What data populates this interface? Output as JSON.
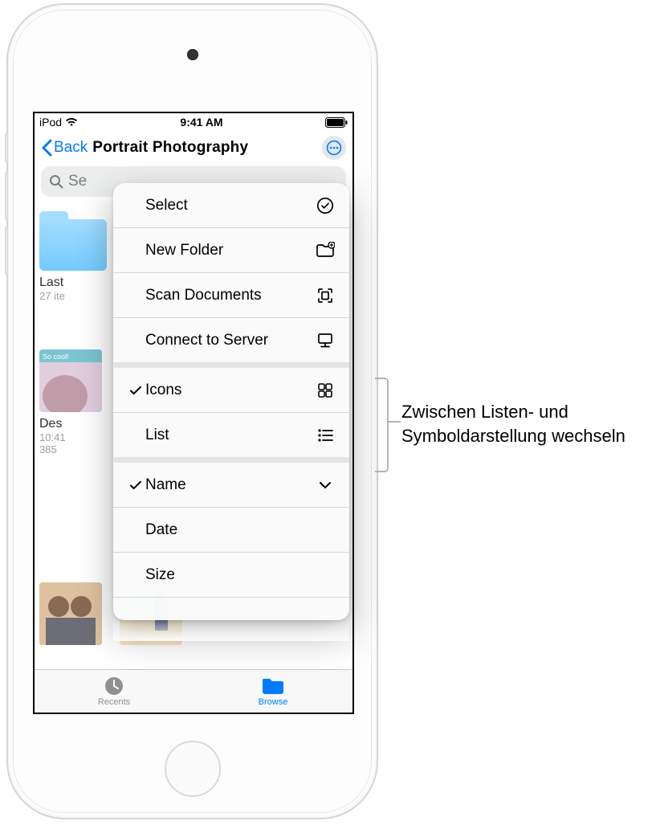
{
  "status": {
    "device": "iPod",
    "time": "9:41 AM"
  },
  "nav": {
    "back": "Back",
    "title": "Portrait Photography"
  },
  "search": {
    "placeholder": "Search",
    "partial": "Se"
  },
  "bg": {
    "folder_label": "Last",
    "folder_sub": "27 ite",
    "item2_label": "Des",
    "item2_time": "10:41",
    "item2_size": "385"
  },
  "menu": {
    "select": "Select",
    "new_folder": "New Folder",
    "scan_docs": "Scan Documents",
    "connect": "Connect to Server",
    "icons": "Icons",
    "list": "List",
    "name": "Name",
    "date": "Date",
    "size": "Size"
  },
  "tabs": {
    "recents": "Recents",
    "browse": "Browse"
  },
  "callout": "Zwischen Listen- und Symboldarstellung wechseln"
}
